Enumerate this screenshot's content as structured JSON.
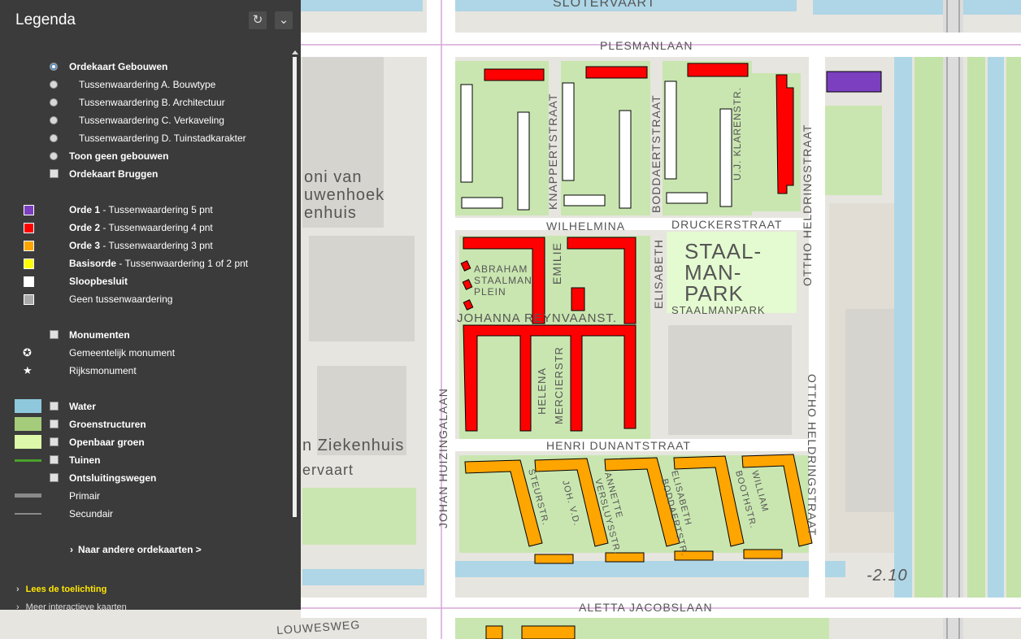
{
  "legend": {
    "title": "Legenda",
    "refresh_icon": "refresh-icon",
    "collapse_icon": "chevron-down-icon",
    "radio_options": [
      {
        "label": "Ordekaart Gebouwen",
        "bold": true,
        "selected": true
      },
      {
        "label": "Tussenwaardering A. Bouwtype",
        "bold": false,
        "selected": false
      },
      {
        "label": "Tussenwaardering B. Architectuur",
        "bold": false,
        "selected": false
      },
      {
        "label": "Tussenwaardering C. Verkaveling",
        "bold": false,
        "selected": false
      },
      {
        "label": "Tussenwaardering D. Tuinstadkarakter",
        "bold": false,
        "selected": false
      },
      {
        "label": "Toon geen gebouwen",
        "bold": true,
        "selected": false
      }
    ],
    "bruggen": "Ordekaart Bruggen",
    "orde": [
      {
        "strong": "Orde 1",
        "rest": " - Tussenwaardering 5 pnt",
        "color": "#7b3fbf"
      },
      {
        "strong": "Orde 2",
        "rest": " - Tussenwaardering 4 pnt",
        "color": "#ff0000"
      },
      {
        "strong": "Orde 3",
        "rest": " - Tussenwaardering 3 pnt",
        "color": "#ffa500"
      },
      {
        "strong": "Basisorde",
        "rest": " - Tussenwaardering 1 of 2 pnt",
        "color": "#ffff00"
      },
      {
        "strong": "Sloopbesluit",
        "rest": "",
        "color": "#ffffff"
      },
      {
        "strong": "",
        "rest": "Geen tussenwaardering",
        "color": "#aaaaaa"
      }
    ],
    "monumenten": "Monumenten",
    "gemeentelijk": "Gemeentelijk monument",
    "rijks": "Rijksmonument",
    "layers": [
      {
        "label": "Water",
        "color": "#8ec8dd"
      },
      {
        "label": "Groenstructuren",
        "color": "#a4cc7a"
      },
      {
        "label": "Openbaar groen",
        "color": "#dcf8a8"
      },
      {
        "label": "Tuinen",
        "color": "#4aa32a"
      }
    ],
    "ontsluiting": "Ontsluitingswegen",
    "primair": "Primair",
    "secundair": "Secundair",
    "naar": "Naar andere ordekaarten >",
    "lees": "Lees de toelichting",
    "meer": "Meer interactieve kaarten"
  },
  "map": {
    "streets": {
      "plesmanlaan": "PLESMANLAAN",
      "sloten": "SLOTERVAART",
      "knappert": "KNAPPERTSTRAAT",
      "boddaert": "BODDAERTSTRAAT",
      "klarenstr": "U.J. KLARENSTR.",
      "heldring1": "OTTHO HELDRINGSTRAAT",
      "wilhelmina": "WILHELMINA",
      "drucker": "DRUCKERSTRAAT",
      "abraham": "ABRAHAM",
      "staalman": "STAALMAN",
      "plein": "PLEIN",
      "emilie": "EMILIE",
      "elisabeth": "ELISABETH",
      "park1": "STAAL-",
      "park2": "MAN-",
      "park3": "PARK",
      "park4": "STAALMANPARK",
      "johanna": "JOHANNA REYNVAANST.",
      "helena": "HELENA",
      "mercier": "MERCIERSTR",
      "huizinga": "JOHAN HUIZINGALAAN",
      "dunant": "HENRI DUNANTSTRAAT",
      "heldring2": "OTTHO HELDRINGSTRAAT",
      "steurstr": "STEURSTR.",
      "johvd": "JOH. V.D.",
      "annette": "ANNETTE",
      "versluys": "VERSLUYSSTR.",
      "elisabeth2": "ELISABETH",
      "boddaertstr2": "BODDAERTSTR.",
      "william": "WILLIAM",
      "booth": "BOOTHSTR.",
      "aletta": "ALETTA JACOBSLAAN",
      "louwesweg": "LOUWESWEG",
      "level": "-2.10",
      "oni": "oni van",
      "uwenhoek": "uwenhoek",
      "enhuis": "enhuis",
      "ziekenhuis": "n Ziekenhuis",
      "ervaart": "ervaart"
    }
  }
}
